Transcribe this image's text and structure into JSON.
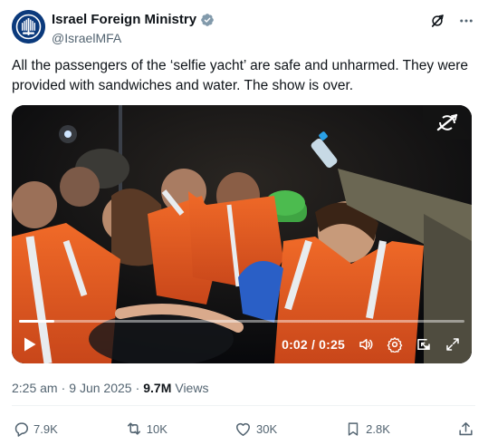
{
  "author": {
    "display_name": "Israel Foreign Ministry",
    "handle": "@IsraelMFA",
    "verified_color": "#829aab"
  },
  "tweet": {
    "text": "All the passengers of the ‘selfie yacht’ are safe and unharmed. They were provided with sandwiches and water. The show is over."
  },
  "video": {
    "time_display": "0:02 / 0:25",
    "progress_fraction": 0.08
  },
  "meta": {
    "time": "2:25 am",
    "separator": "·",
    "date": "9 Jun 2025",
    "views_count": "9.7M",
    "views_label": "Views"
  },
  "actions": {
    "replies": "7.9K",
    "reposts": "10K",
    "likes": "30K",
    "bookmarks": "2.8K"
  },
  "icons": {
    "avatar": "ministry-seal-icon",
    "verified": "verified-badge-icon",
    "grok": "grok-icon",
    "more": "more-icon",
    "play": "play-icon",
    "volume": "volume-icon",
    "settings": "gear-icon",
    "pip": "picture-in-picture-icon",
    "fullscreen": "fullscreen-icon",
    "reply": "reply-icon",
    "repost": "repost-icon",
    "like": "heart-icon",
    "bookmark": "bookmark-icon",
    "share": "share-icon"
  },
  "colors": {
    "text": "#0f1419",
    "secondary": "#536471",
    "divider": "#eff3f4"
  }
}
